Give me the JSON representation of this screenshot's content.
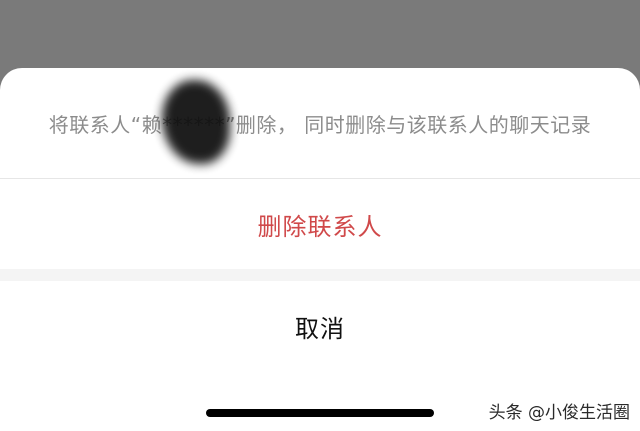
{
  "dialog": {
    "prompt_text": "将联系人“赖******”删除， 同时删除与该联系人的聊天记录",
    "delete_label": "删除联系人",
    "cancel_label": "取消"
  },
  "watermark": {
    "text": "头条 @小俊生活圈"
  },
  "colors": {
    "overlay": "#7a7a7a",
    "sheet": "#ffffff",
    "destructive": "#d0494a",
    "prompt": "#8c8c8c",
    "primary_text": "#111111"
  }
}
